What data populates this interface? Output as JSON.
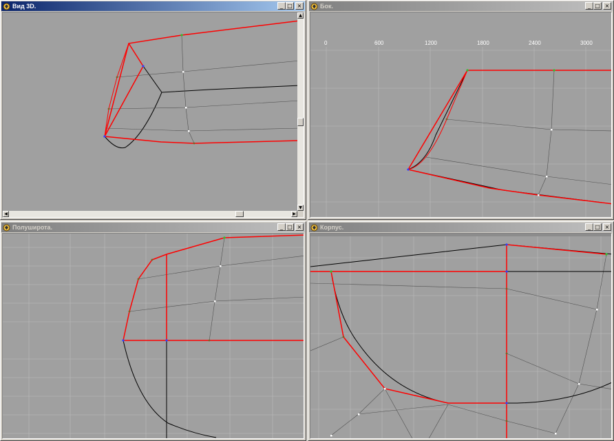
{
  "windows": {
    "view3d": {
      "title": "Вид 3D."
    },
    "side": {
      "title": "Бок.",
      "ruler_ticks": [
        "0",
        "600",
        "1200",
        "1800",
        "2400",
        "3000"
      ]
    },
    "halfbreadth": {
      "title": "Полуширота."
    },
    "body": {
      "title": "Корпус."
    }
  },
  "controls": {
    "minimize": "_",
    "maximize": "□",
    "close": "×"
  },
  "colors": {
    "viewport_bg": "#a0a0a0",
    "grid": "#b8b8b8",
    "grid_bright": "#c8c8c8",
    "hull_edge": "#ff0000",
    "hull_line": "#000000",
    "control_line": "#505050",
    "active_title": "#0a246a"
  }
}
